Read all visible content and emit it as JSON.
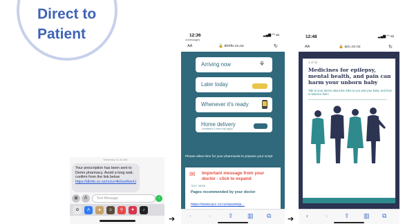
{
  "title": {
    "line1": "Direct to",
    "line2": "Patient"
  },
  "arrows": {
    "first": "➔",
    "second": "➔"
  },
  "messages": {
    "date": "Yesterday 11:44 AM",
    "body_prefix": "Your prescription has been sent to Demo pharmacy. Avoid a long wait, confirm from the link below ",
    "link": "https://dlinfo.co.nz/rx/scr4k6zwRwnU",
    "input_placeholder": "Text Message",
    "camera_icon": "camera-icon",
    "apps_icon": "app-store-icon"
  },
  "pharmacy": {
    "time": "12:36",
    "back_label": "◂ Messages",
    "aa": "AA",
    "domain": "🔒 drinfo.co.nz",
    "options": [
      {
        "label": "Arriving now",
        "sub": "",
        "icon": "walking-icon"
      },
      {
        "label": "Later today",
        "sub": "",
        "icon": "car-icon"
      },
      {
        "label": "Whenever it's ready",
        "sub": "",
        "icon": "phone-icon"
      },
      {
        "label": "Home delivery",
        "sub": "conditions & fees may apply",
        "icon": "delivery-truck-icon"
      }
    ],
    "notice": "Please allow time for your pharmacist to prepare your script",
    "important": "Important message from your doctor - click to expand",
    "important_icon": "message-icon",
    "card_label": "TEXT HERE",
    "card_heading": "Pages recommended by your doctor",
    "card_link": "https://www.acc.co.nz/assets/p..."
  },
  "acc": {
    "time": "12:48",
    "aa": "AA",
    "domain": "🔒 acc.co.nz",
    "page": "1 of 32",
    "title": "Medicines for epilepsy, mental health, and pain can harm your unborn baby",
    "subtitle": "Talk to your doctor about the risks to you and your baby, and how to balance them"
  },
  "colors": {
    "title_blue": "#3f63b8",
    "pharmacy_teal": "#2f697b",
    "acc_navy": "#2c3452",
    "important_red": "#e34b3c",
    "link_blue": "#1f55d6"
  }
}
